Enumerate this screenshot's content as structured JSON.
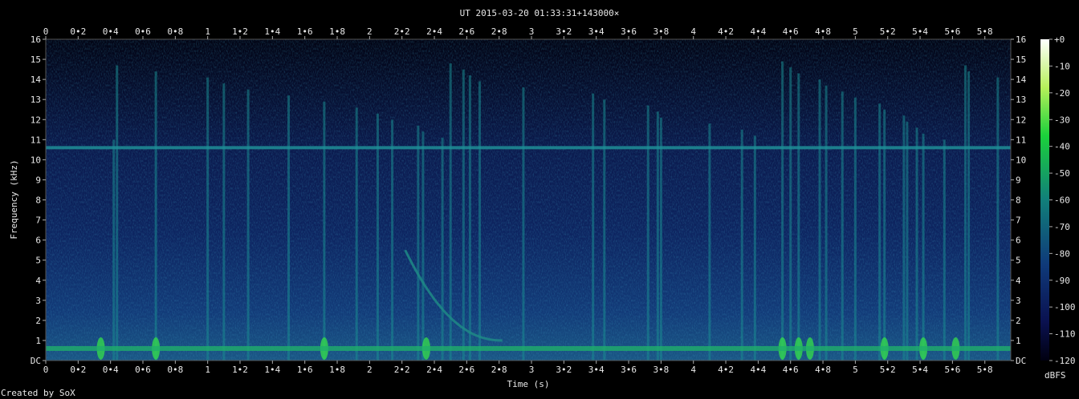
{
  "chart_data": {
    "type": "heatmap",
    "title": "UT 2015-03-20 01:33:31+143000×",
    "xlabel": "Time (s)",
    "ylabel": "Frequency (kHz)",
    "x_ticks": [
      "0",
      "0•2",
      "0•4",
      "0•6",
      "0•8",
      "1",
      "1•2",
      "1•4",
      "1•6",
      "1•8",
      "2",
      "2•2",
      "2•4",
      "2•6",
      "2•8",
      "3",
      "3•2",
      "3•4",
      "3•6",
      "3•8",
      "4",
      "4•2",
      "4•4",
      "4•6",
      "4•8",
      "5",
      "5•2",
      "5•4",
      "5•6",
      "5•8"
    ],
    "y_ticks": [
      "DC",
      "1",
      "2",
      "3",
      "4",
      "5",
      "6",
      "7",
      "8",
      "9",
      "10",
      "11",
      "12",
      "13",
      "14",
      "15",
      "16"
    ],
    "xlim": [
      0,
      5.96
    ],
    "ylim": [
      0,
      16
    ],
    "colorbar": {
      "label": "dBFS",
      "ticks": [
        "+0",
        "-10",
        "-20",
        "-30",
        "-40",
        "-50",
        "-60",
        "-70",
        "-80",
        "-90",
        "-100",
        "-110",
        "-120"
      ],
      "range": [
        -120,
        0
      ]
    },
    "features": {
      "hum_line_khz": 10.6,
      "low_band_khz": 0.6,
      "vertical_bursts_s": [
        0.42,
        0.44,
        0.68,
        1.0,
        1.1,
        1.25,
        1.5,
        1.72,
        1.92,
        2.05,
        2.14,
        2.3,
        2.33,
        2.45,
        2.5,
        2.58,
        2.62,
        2.68,
        2.95,
        3.38,
        3.45,
        3.72,
        3.78,
        3.8,
        4.1,
        4.3,
        4.38,
        4.55,
        4.6,
        4.65,
        4.78,
        4.82,
        4.92,
        5.0,
        5.15,
        5.18,
        5.3,
        5.32,
        5.38,
        5.42,
        5.55,
        5.68,
        5.7,
        5.88
      ],
      "bright_bursts_s": [
        0.34,
        0.68,
        1.72,
        2.35,
        4.55,
        4.65,
        4.72,
        5.18,
        5.42,
        5.62
      ],
      "chirp": {
        "t_start": 2.22,
        "f_start": 5.5,
        "t_end": 2.82,
        "f_end": 1.0
      }
    }
  },
  "credit": "Created by SoX"
}
